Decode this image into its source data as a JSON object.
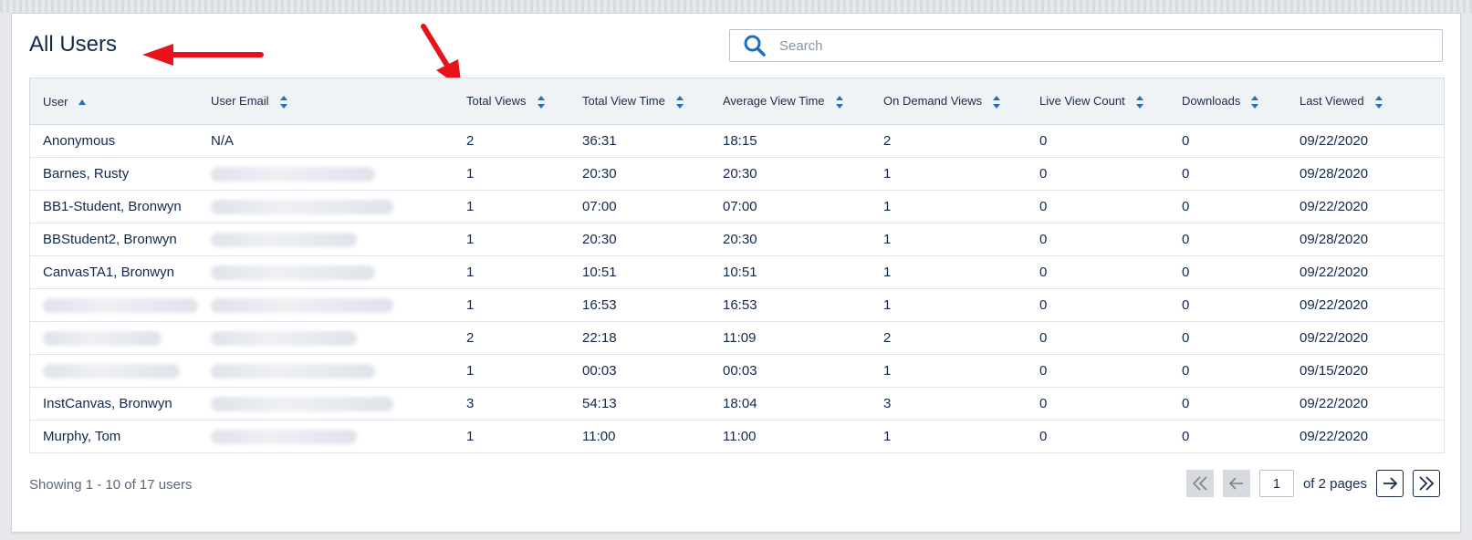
{
  "page": {
    "title": "All Users"
  },
  "search": {
    "placeholder": "Search"
  },
  "table": {
    "columns": [
      "User",
      "User Email",
      "Total Views",
      "Total View Time",
      "Average View Time",
      "On Demand Views",
      "Live View Count",
      "Downloads",
      "Last Viewed"
    ],
    "rows": [
      {
        "user": "Anonymous",
        "email": "N/A",
        "total_views": "2",
        "total_view_time": "36:31",
        "avg_view_time": "18:15",
        "on_demand": "2",
        "live": "0",
        "downloads": "0",
        "last_viewed": "09/22/2020"
      },
      {
        "user": "Barnes, Rusty",
        "email": "",
        "total_views": "1",
        "total_view_time": "20:30",
        "avg_view_time": "20:30",
        "on_demand": "1",
        "live": "0",
        "downloads": "0",
        "last_viewed": "09/28/2020"
      },
      {
        "user": "BB1-Student, Bronwyn",
        "email": "",
        "total_views": "1",
        "total_view_time": "07:00",
        "avg_view_time": "07:00",
        "on_demand": "1",
        "live": "0",
        "downloads": "0",
        "last_viewed": "09/22/2020"
      },
      {
        "user": "BBStudent2, Bronwyn",
        "email": "",
        "total_views": "1",
        "total_view_time": "20:30",
        "avg_view_time": "20:30",
        "on_demand": "1",
        "live": "0",
        "downloads": "0",
        "last_viewed": "09/28/2020"
      },
      {
        "user": "CanvasTA1, Bronwyn",
        "email": "",
        "total_views": "1",
        "total_view_time": "10:51",
        "avg_view_time": "10:51",
        "on_demand": "1",
        "live": "0",
        "downloads": "0",
        "last_viewed": "09/22/2020"
      },
      {
        "user": "",
        "email": "",
        "total_views": "1",
        "total_view_time": "16:53",
        "avg_view_time": "16:53",
        "on_demand": "1",
        "live": "0",
        "downloads": "0",
        "last_viewed": "09/22/2020"
      },
      {
        "user": "",
        "email": "",
        "total_views": "2",
        "total_view_time": "22:18",
        "avg_view_time": "11:09",
        "on_demand": "2",
        "live": "0",
        "downloads": "0",
        "last_viewed": "09/22/2020"
      },
      {
        "user": "",
        "email": "",
        "total_views": "1",
        "total_view_time": "00:03",
        "avg_view_time": "00:03",
        "on_demand": "1",
        "live": "0",
        "downloads": "0",
        "last_viewed": "09/15/2020"
      },
      {
        "user": "InstCanvas, Bronwyn",
        "email": "",
        "total_views": "3",
        "total_view_time": "54:13",
        "avg_view_time": "18:04",
        "on_demand": "3",
        "live": "0",
        "downloads": "0",
        "last_viewed": "09/22/2020"
      },
      {
        "user": "Murphy, Tom",
        "email": "",
        "total_views": "1",
        "total_view_time": "11:00",
        "avg_view_time": "11:00",
        "on_demand": "1",
        "live": "0",
        "downloads": "0",
        "last_viewed": "09/22/2020"
      }
    ]
  },
  "footer": {
    "showing": "Showing 1 - 10 of 17 users"
  },
  "pagination": {
    "current_page": "1",
    "of_pages": "of 2 pages"
  },
  "colors": {
    "accent": "#1f6fc0",
    "annotation_arrow": "#e8121b",
    "text": "#12284c"
  },
  "icons": {
    "search": "search-icon",
    "sort": "sort-icon",
    "first": "double-chevron-left-icon",
    "prev": "arrow-left-icon",
    "next": "arrow-right-icon",
    "last": "double-chevron-right-icon"
  }
}
